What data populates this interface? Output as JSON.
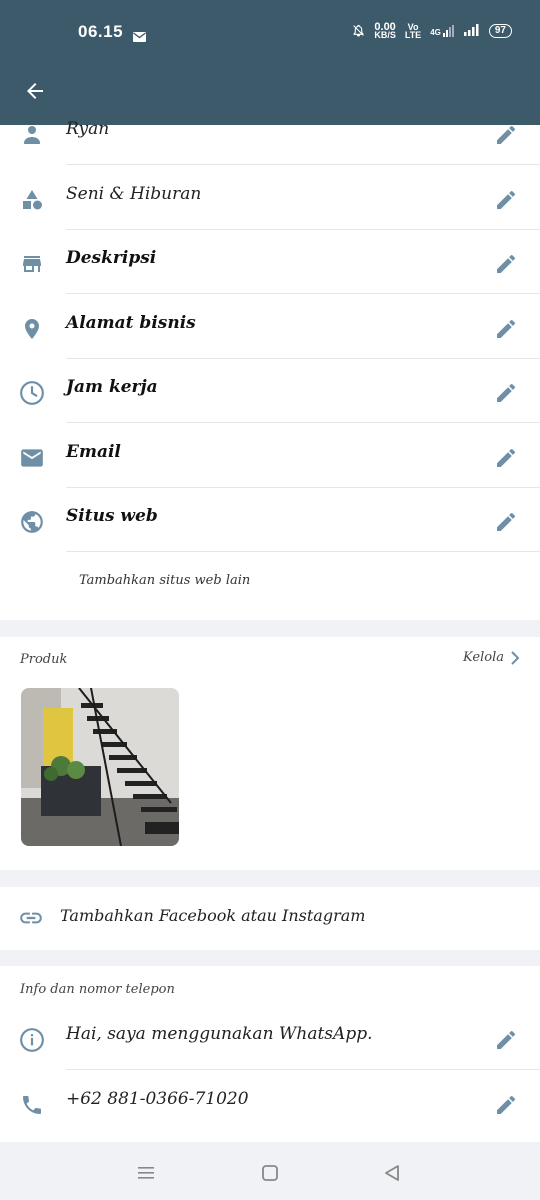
{
  "status_bar": {
    "time": "06.15",
    "net_speed_value": "0.00",
    "net_speed_unit": "KB/S",
    "volte_top": "Vo",
    "volte_bottom": "LTE",
    "network": "4G",
    "battery": "97"
  },
  "profile_rows": [
    {
      "label": "Ryan",
      "icon": "person-icon",
      "bold": false
    },
    {
      "label": "Seni & Hiburan",
      "icon": "category-shapes-icon",
      "bold": false
    },
    {
      "label": "Deskripsi",
      "icon": "store-icon",
      "bold": true
    },
    {
      "label": "Alamat bisnis",
      "icon": "location-pin-icon",
      "bold": true
    },
    {
      "label": "Jam kerja",
      "icon": "clock-icon",
      "bold": true
    },
    {
      "label": "Email",
      "icon": "email-icon",
      "bold": true
    },
    {
      "label": "Situs web",
      "icon": "globe-icon",
      "bold": true
    }
  ],
  "add_website": "Tambahkan situs web lain",
  "products": {
    "title": "Produk",
    "manage_label": "Kelola"
  },
  "social": {
    "label": "Tambahkan Facebook atau Instagram"
  },
  "info": {
    "title": "Info dan nomor telepon",
    "about": "Hai, saya menggunakan WhatsApp.",
    "phone": "+62 881-0366-71020"
  },
  "colors": {
    "header": "#3c5a6a",
    "icon": "#6f8fa6",
    "background": "#f0f2f5"
  }
}
